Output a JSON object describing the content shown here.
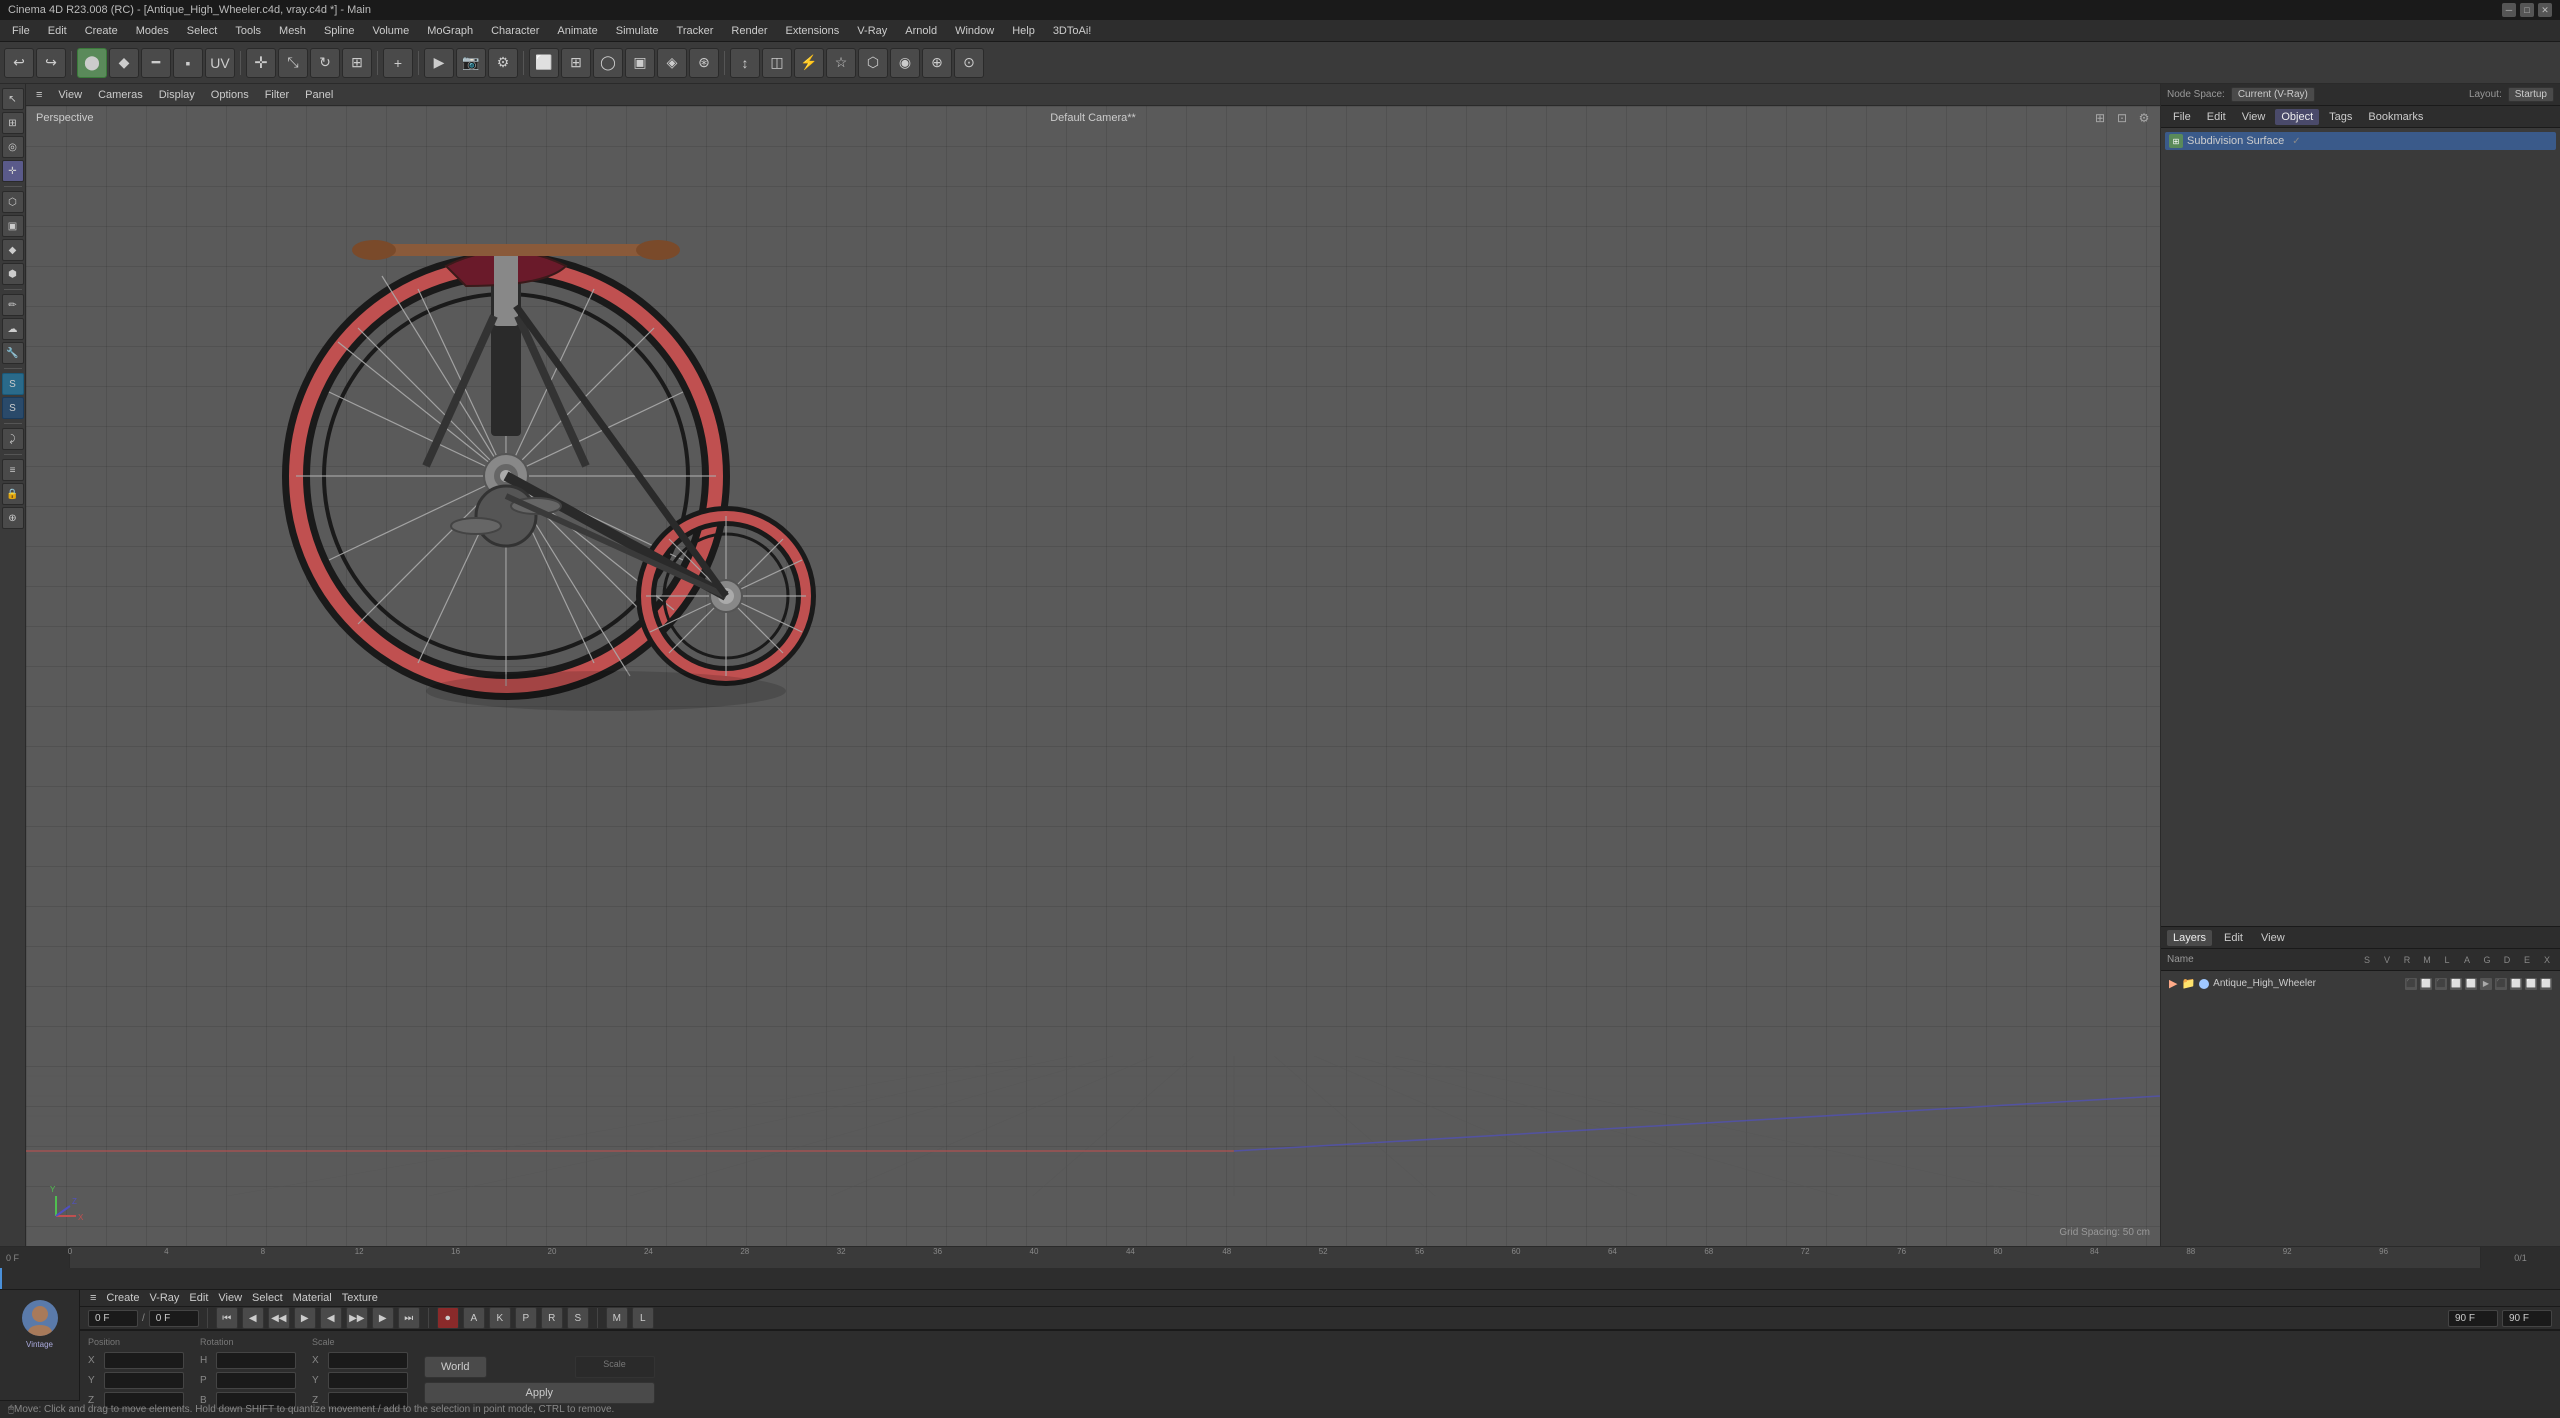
{
  "titleBar": {
    "title": "Cinema 4D R23.008 (RC) - [Antique_High_Wheeler.c4d, vray.c4d *] - Main"
  },
  "menuBar": {
    "items": [
      "File",
      "Edit",
      "Create",
      "Modes",
      "Select",
      "Tools",
      "Mesh",
      "Spline",
      "Volume",
      "MoGraph",
      "Character",
      "Animate",
      "Simulate",
      "Tracker",
      "Render",
      "Extensions",
      "V-Ray",
      "Arnold",
      "Window",
      "Help",
      "3DToAi!"
    ]
  },
  "viewport": {
    "label": "Perspective",
    "camera": "Default Camera**",
    "gridSpacing": "Grid Spacing: 50 cm"
  },
  "rightPanel": {
    "tabs": [
      "File",
      "Edit",
      "View",
      "Object",
      "Tags",
      "Bookmarks"
    ],
    "nodeSpaceLabel": "Node Space:",
    "nodeSpaceValue": "Current (V-Ray)",
    "layoutLabel": "Layout:",
    "layoutValue": "Startup",
    "objectName": "Subdivision Surface"
  },
  "layersPanel": {
    "tabs": [
      "Layers",
      "Edit",
      "View"
    ],
    "columns": {
      "name": "Name",
      "letters": [
        "S",
        "V",
        "R",
        "M",
        "L",
        "A",
        "G",
        "D",
        "E",
        "X"
      ]
    },
    "items": [
      {
        "name": "Antique_High_Wheeler",
        "color": "#a0c8ff"
      }
    ]
  },
  "timeline": {
    "ticks": [
      "0",
      "4",
      "8",
      "12",
      "16",
      "20",
      "24",
      "28",
      "32",
      "36",
      "40",
      "44",
      "48",
      "52",
      "56",
      "60",
      "64",
      "68",
      "72",
      "76",
      "80",
      "84",
      "88",
      "92",
      "96"
    ],
    "startFrame": "0 F",
    "currentFrame": "0 F",
    "endFrame": "90 F",
    "maxFrame": "90 F"
  },
  "transport": {
    "startBtn": "⏮",
    "prevBtn": "◀◀",
    "playBtn": "▶",
    "stopBtn": "⏹",
    "nextBtn": "▶▶",
    "endBtn": "⏭",
    "recordBtn": "⏺"
  },
  "bottomEditBar": {
    "items": [
      "Create",
      "V-Ray",
      "Edit",
      "View",
      "Select",
      "Material",
      "Texture"
    ]
  },
  "coordinates": {
    "position": {
      "label": "Position",
      "x": "",
      "y": "",
      "z": ""
    },
    "rotation": {
      "label": "Rotation",
      "h": "",
      "p": "",
      "b": ""
    },
    "scale": {
      "label": "Scale",
      "x": "",
      "y": "",
      "z": ""
    },
    "worldBtn": "World",
    "applyBtn": "Apply"
  },
  "statusBar": {
    "message": "Move: Click and drag to move elements. Hold down SHIFT to quantize movement / add to the selection in point mode, CTRL to remove."
  }
}
